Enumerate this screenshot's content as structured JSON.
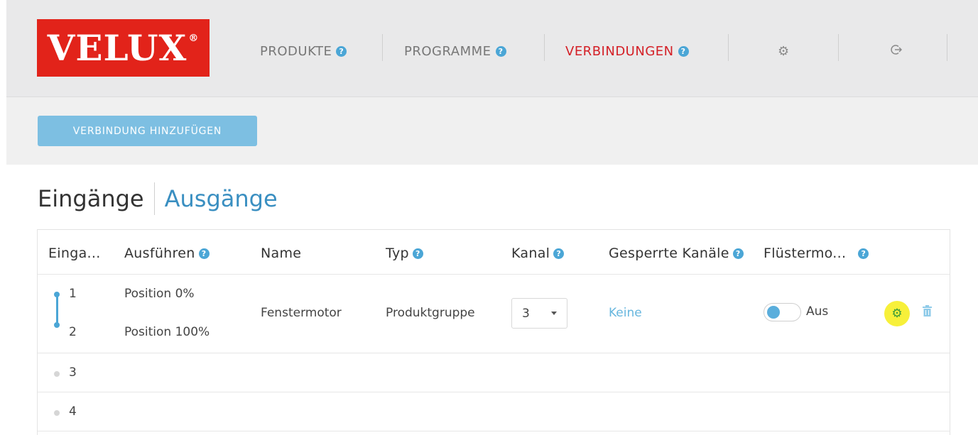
{
  "logo": {
    "text": "VELUX",
    "reg": "®"
  },
  "nav": {
    "items": [
      {
        "label": "PRODUKTE",
        "active": false
      },
      {
        "label": "PROGRAMME",
        "active": false
      },
      {
        "label": "VERBINDUNGEN",
        "active": true
      }
    ],
    "settings_icon": "gear-icon",
    "logout_icon": "logout-icon"
  },
  "toolbar": {
    "add_label": "VERBINDUNG HINZUFÜGEN"
  },
  "tabs": {
    "inputs": "Eingänge",
    "outputs": "Ausgänge",
    "active": "outputs"
  },
  "table": {
    "headers": {
      "input": "Einga...",
      "execute": "Ausführen",
      "name": "Name",
      "type": "Typ",
      "channel": "Kanal",
      "locked": "Gesperrte Kanäle",
      "whisper": "Flüstermo..."
    },
    "rows": [
      {
        "inputs": [
          "1",
          "2"
        ],
        "actions": [
          "Position 0%",
          "Position 100%"
        ],
        "name": "Fenstermotor",
        "type": "Produktgruppe",
        "channel": "3",
        "locked": "Keine",
        "whisper": "Aus",
        "whisper_on": false
      },
      {
        "inputs": [
          "3"
        ]
      },
      {
        "inputs": [
          "4"
        ]
      }
    ]
  },
  "colors": {
    "brand": "#e2231a",
    "accent": "#4ba6d6",
    "active_nav": "#d42027",
    "highlight": "#f7f03a"
  }
}
